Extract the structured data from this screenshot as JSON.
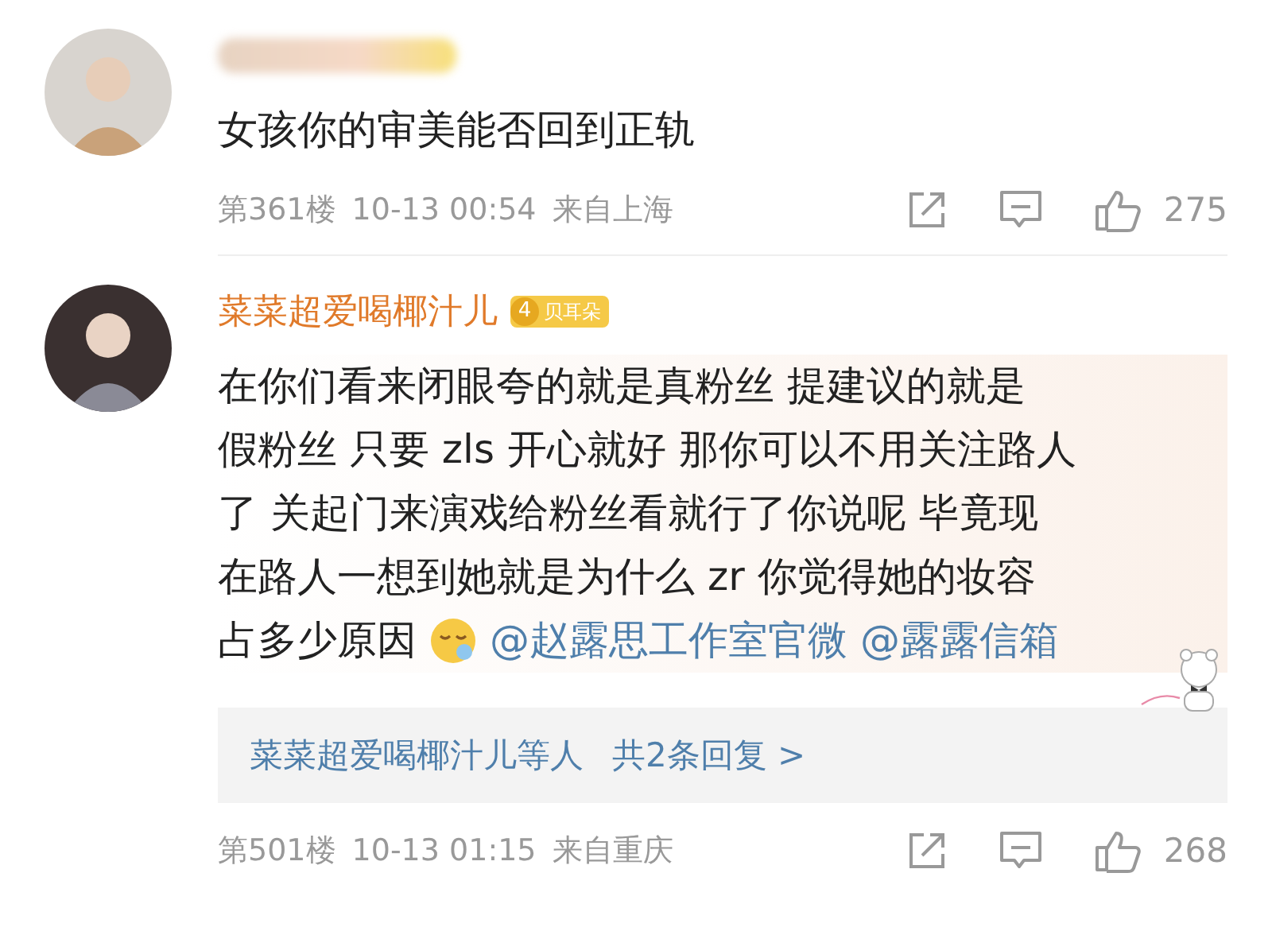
{
  "comments": [
    {
      "name": {
        "kind": "blurred"
      },
      "lines": [
        [
          {
            "kind": "text",
            "text": "女孩你的审美能否回到正轨"
          }
        ]
      ],
      "floor": "第361楼",
      "time": "10-13 00:54",
      "location": "来自上海",
      "likes": "275"
    },
    {
      "name": {
        "kind": "plain",
        "text": "菜菜超爱喝椰汁儿"
      },
      "badge": {
        "level": "4",
        "label": "贝耳朵"
      },
      "decorated": true,
      "lines": [
        [
          {
            "kind": "text",
            "text": "在你们看来闭眼夸的就是真粉丝 提建议的就是"
          }
        ],
        [
          {
            "kind": "text",
            "text": "假粉丝 只要 zls 开心就好 那你可以不用关注路人"
          }
        ],
        [
          {
            "kind": "text",
            "text": "了 关起门来演戏给粉丝看就行了你说呢 毕竟现"
          }
        ],
        [
          {
            "kind": "text",
            "text": "在路人一想到她就是为什么 zr 你觉得她的妆容"
          }
        ],
        [
          {
            "kind": "text",
            "text": "占多少原因"
          },
          {
            "kind": "emoji"
          },
          {
            "kind": "mention",
            "text": "@赵露思工作室官微"
          },
          {
            "kind": "mention",
            "text": "@露露信箱"
          }
        ]
      ],
      "replies": {
        "who": "菜菜超爱喝椰汁儿等人",
        "count": "共2条回复 >"
      },
      "floor": "第501楼",
      "time": "10-13 01:15",
      "location": "来自重庆",
      "likes": "268"
    }
  ]
}
